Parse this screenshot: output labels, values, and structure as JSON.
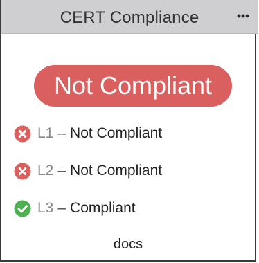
{
  "header": {
    "title": "CERT Compliance",
    "menu_icon": "more-horizontal-icon"
  },
  "overall": {
    "status": "Not Compliant",
    "color": "#d9605f"
  },
  "levels": [
    {
      "code": "L1",
      "separator": "–",
      "status": "Not Compliant",
      "icon": "x-circle-icon",
      "icon_color": "#d9605f"
    },
    {
      "code": "L2",
      "separator": "–",
      "status": "Not Compliant",
      "icon": "x-circle-icon",
      "icon_color": "#d9605f"
    },
    {
      "code": "L3",
      "separator": "–",
      "status": "Compliant",
      "icon": "check-circle-icon",
      "icon_color": "#4caf50"
    }
  ],
  "footer": {
    "docs_label": "docs"
  }
}
